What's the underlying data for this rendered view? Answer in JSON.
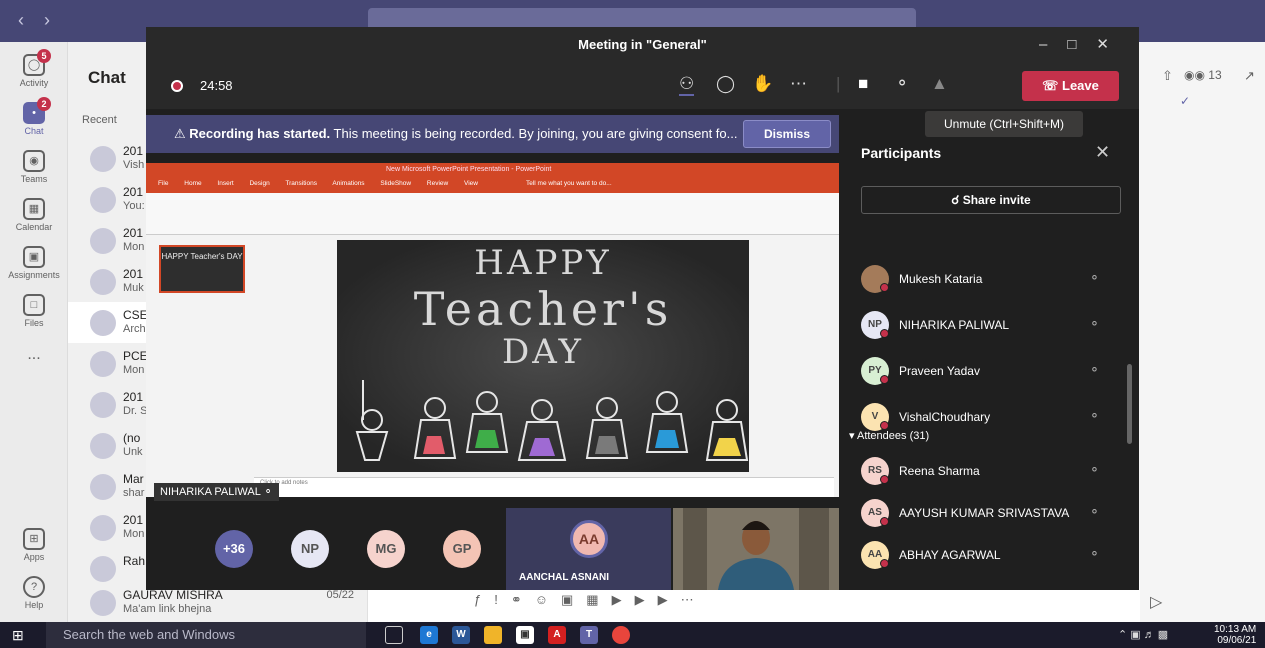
{
  "teams": {
    "chat_header": "Chat",
    "recent_label": "Recent",
    "rail": [
      {
        "label": "Activity",
        "badge": "5"
      },
      {
        "label": "Chat",
        "badge": "2"
      },
      {
        "label": "Teams",
        "badge": ""
      },
      {
        "label": "Calendar",
        "badge": ""
      },
      {
        "label": "Assignments",
        "badge": ""
      },
      {
        "label": "Files",
        "badge": ""
      },
      {
        "label": "...",
        "badge": ""
      },
      {
        "label": "Apps",
        "badge": ""
      },
      {
        "label": "Help",
        "badge": ""
      }
    ],
    "chats": [
      {
        "name": "201",
        "preview": "Vish"
      },
      {
        "name": "201",
        "preview": "You:"
      },
      {
        "name": "201",
        "preview": "Mon"
      },
      {
        "name": "201",
        "preview": "Muk"
      },
      {
        "name": "CSE",
        "preview": "Arch"
      },
      {
        "name": "PCE",
        "preview": "Mon"
      },
      {
        "name": "201",
        "preview": "Dr. S"
      },
      {
        "name": "(no",
        "preview": "Unk"
      },
      {
        "name": "Mar",
        "preview": "shar"
      },
      {
        "name": "201",
        "preview": "Mon"
      },
      {
        "name": "Rah",
        "preview": ""
      },
      {
        "name": "GAURAV MISHRA",
        "preview": "Ma'am link bhejna",
        "date": "05/22"
      }
    ],
    "right_count": "13"
  },
  "meeting": {
    "title": "Meeting in \"General\"",
    "timer": "24:58",
    "leave_label": "Leave",
    "banner_bold": "Recording has started.",
    "banner_text": " This meeting is being recorded. By joining, you are giving consent fo...",
    "dismiss_label": "Dismiss",
    "presenter_name": "NIHARIKA PALIWAL",
    "ppt_title": "New Microsoft PowerPoint Presentation - PowerPoint",
    "ppt_tabs": "File Home Insert Design Transitions Animations SlideShow Review View",
    "ppt_tell_me": "Tell me what you want to do...",
    "ppt_notes": "Click to add notes",
    "thumb_text": "HAPPY Teacher's DAY",
    "slide": {
      "line1": "HAPPY",
      "line2": "Teacher's",
      "line3": "DAY"
    },
    "strip": [
      {
        "initials": "+36",
        "color": "#6264a7"
      },
      {
        "initials": "NP",
        "color": "#e6e7f4"
      },
      {
        "initials": "MG",
        "color": "#f6d3cd"
      },
      {
        "initials": "GP",
        "color": "#f4c4b5"
      }
    ],
    "active_speaker": {
      "initials": "AA",
      "name": "AANCHAL ASNANI"
    }
  },
  "panel": {
    "tooltip": "Unmute (Ctrl+Shift+M)",
    "title": "Participants",
    "share_invite": "Share invite",
    "presenters": [
      {
        "initials": "",
        "name": "Mukesh Kataria",
        "color": "#a47b5a"
      },
      {
        "initials": "NP",
        "name": "NIHARIKA PALIWAL",
        "color": "#e6e7f4"
      },
      {
        "initials": "PY",
        "name": "Praveen Yadav",
        "color": "#d8efd3"
      },
      {
        "initials": "V",
        "name": "VishalChoudhary",
        "color": "#fbe3b1"
      }
    ],
    "attendees_label": "Attendees (31)",
    "attendees": [
      {
        "initials": "RS",
        "name": "Reena Sharma",
        "color": "#f6d3cd"
      },
      {
        "initials": "AS",
        "name": "AAYUSH KUMAR SRIVASTAVA",
        "color": "#f6d3cd"
      },
      {
        "initials": "AA",
        "name": "ABHAY AGARWAL",
        "color": "#fbe3b1"
      }
    ]
  },
  "taskbar": {
    "search_placeholder": "Search the web and Windows",
    "time": "10:13 AM",
    "date": "09/06/21"
  }
}
